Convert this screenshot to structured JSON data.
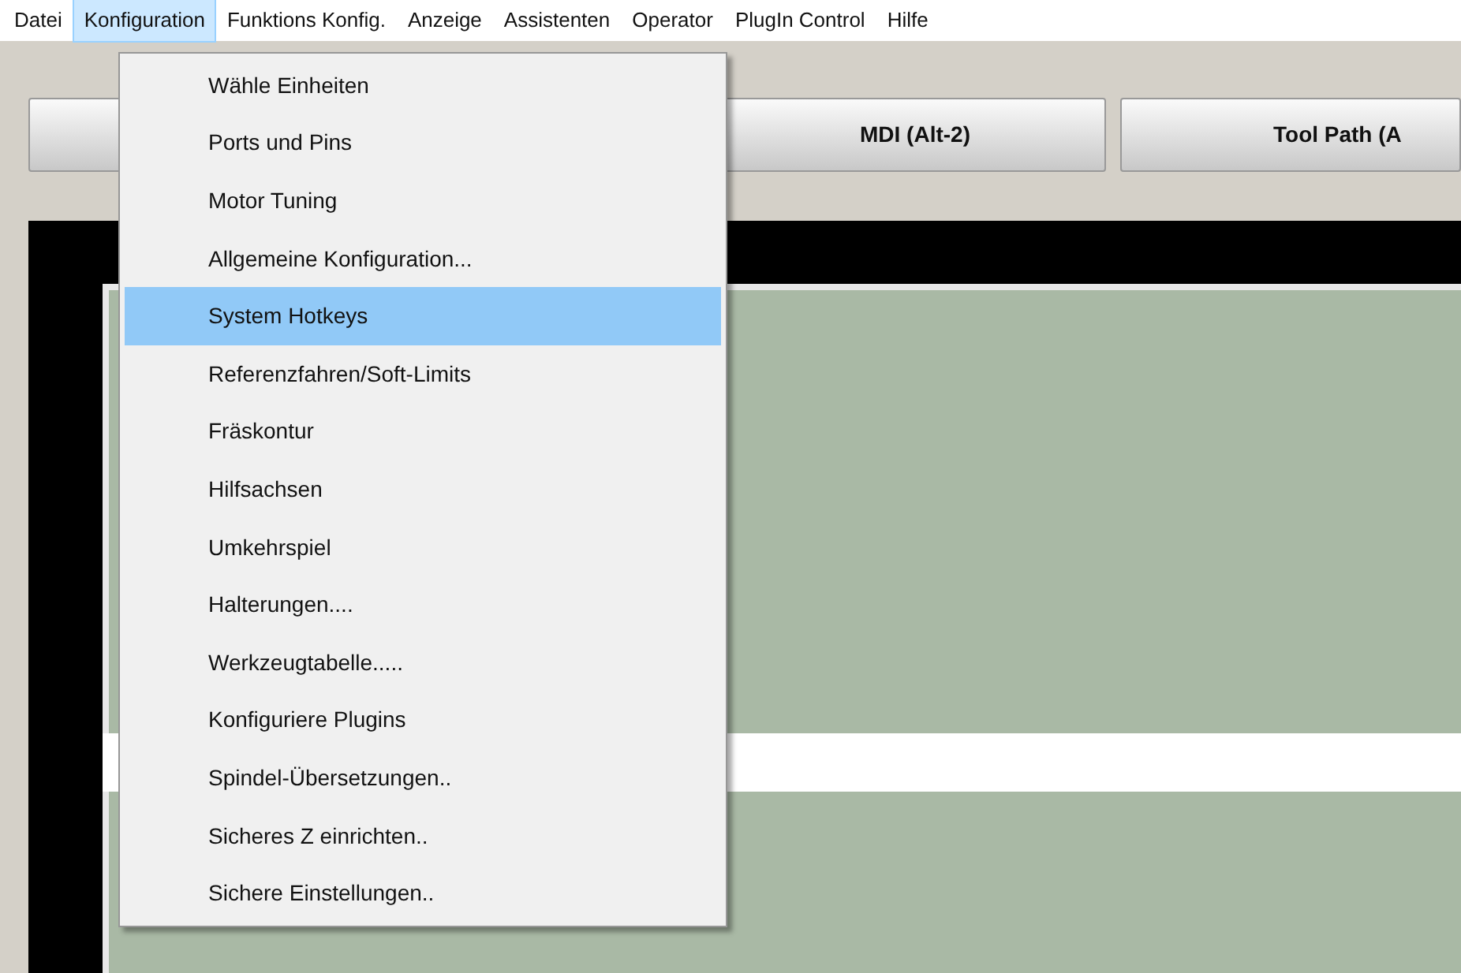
{
  "menu_bar": [
    {
      "label": "Datei",
      "selected": false
    },
    {
      "label": "Konfiguration",
      "selected": true
    },
    {
      "label": "Funktions Konfig.",
      "selected": false
    },
    {
      "label": "Anzeige",
      "selected": false
    },
    {
      "label": "Assistenten",
      "selected": false
    },
    {
      "label": "Operator",
      "selected": false
    },
    {
      "label": "PlugIn Control",
      "selected": false
    },
    {
      "label": "Hilfe",
      "selected": false
    }
  ],
  "tab_buttons": [
    {
      "label": "MDI (Alt-2)"
    },
    {
      "label": "Tool Path (A"
    }
  ],
  "dropdown_menu": [
    {
      "label": "Wähle Einheiten",
      "selected": false
    },
    {
      "label": "Ports und Pins",
      "selected": false
    },
    {
      "label": "Motor Tuning",
      "selected": false
    },
    {
      "label": "Allgemeine Konfiguration...",
      "selected": false
    },
    {
      "label": "System Hotkeys",
      "selected": true
    },
    {
      "label": "Referenzfahren/Soft-Limits",
      "selected": false
    },
    {
      "label": "Fräskontur",
      "selected": false
    },
    {
      "label": "Hilfsachsen",
      "selected": false
    },
    {
      "label": "Umkehrspiel",
      "selected": false
    },
    {
      "label": "Halterungen....",
      "selected": false
    },
    {
      "label": "Werkzeugtabelle.....",
      "selected": false
    },
    {
      "label": "Konfiguriere Plugins",
      "selected": false
    },
    {
      "label": "Spindel-Übersetzungen..",
      "selected": false
    },
    {
      "label": "Sicheres Z einrichten..",
      "selected": false
    },
    {
      "label": "Sichere Einstellungen..",
      "selected": false
    }
  ]
}
